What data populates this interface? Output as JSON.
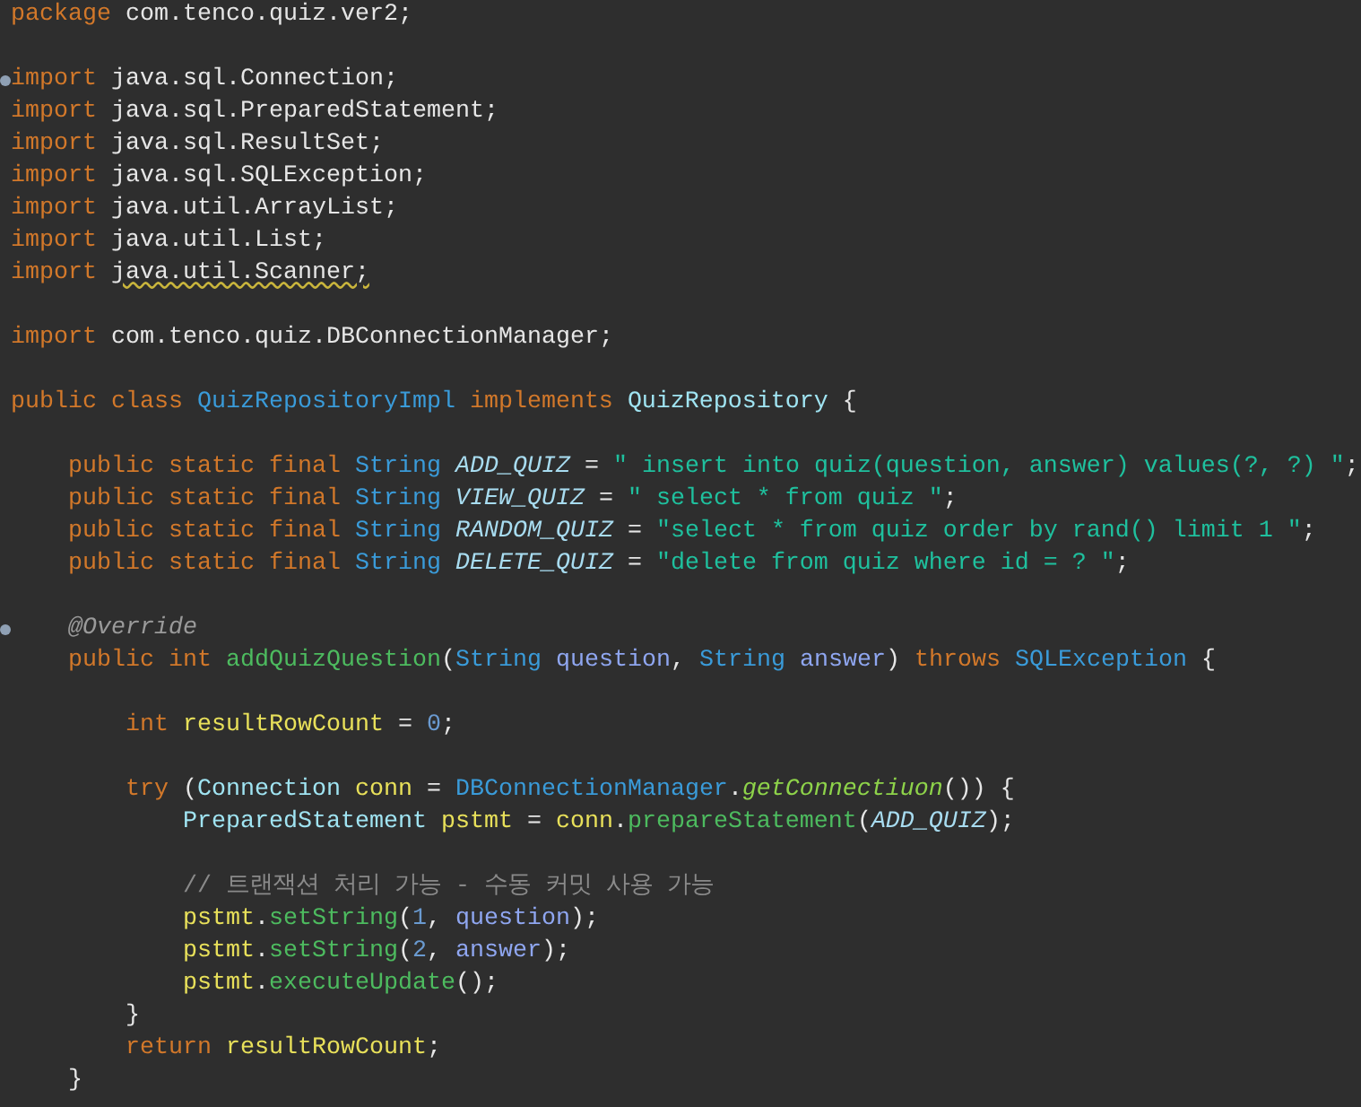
{
  "editor": {
    "lines": [
      {
        "kind": "code",
        "tokens": [
          {
            "text": "package ",
            "kind": "keyword"
          },
          {
            "text": "com.tenco.quiz.ver2;",
            "kind": "plain"
          }
        ]
      },
      {
        "kind": "blank"
      },
      {
        "kind": "marked",
        "tokens": [
          {
            "text": "import ",
            "kind": "keyword"
          },
          {
            "text": "java.sql.Connection;",
            "kind": "plain"
          }
        ]
      },
      {
        "kind": "code",
        "tokens": [
          {
            "text": "import ",
            "kind": "keyword"
          },
          {
            "text": "java.sql.PreparedStatement;",
            "kind": "plain"
          }
        ]
      },
      {
        "kind": "code",
        "tokens": [
          {
            "text": "import ",
            "kind": "keyword"
          },
          {
            "text": "java.sql.ResultSet;",
            "kind": "plain"
          }
        ]
      },
      {
        "kind": "code",
        "tokens": [
          {
            "text": "import ",
            "kind": "keyword"
          },
          {
            "text": "java.sql.SQLException;",
            "kind": "plain"
          }
        ]
      },
      {
        "kind": "code",
        "tokens": [
          {
            "text": "import ",
            "kind": "keyword"
          },
          {
            "text": "java.util.ArrayList;",
            "kind": "plain"
          }
        ]
      },
      {
        "kind": "code",
        "tokens": [
          {
            "text": "import ",
            "kind": "keyword"
          },
          {
            "text": "java.util.List;",
            "kind": "plain"
          }
        ]
      },
      {
        "kind": "code",
        "tokens": [
          {
            "text": "import ",
            "kind": "keyword"
          },
          {
            "text": "java.util.Scanner;",
            "kind": "warning"
          }
        ]
      },
      {
        "kind": "blank"
      },
      {
        "kind": "code",
        "tokens": [
          {
            "text": "import ",
            "kind": "keyword"
          },
          {
            "text": "com.tenco.quiz.DBConnectionManager;",
            "kind": "plain"
          }
        ]
      },
      {
        "kind": "blank"
      },
      {
        "kind": "code",
        "tokens": [
          {
            "text": "public class ",
            "kind": "keyword"
          },
          {
            "text": "QuizRepositoryImpl ",
            "kind": "type"
          },
          {
            "text": "implements ",
            "kind": "keyword"
          },
          {
            "text": "QuizRepository ",
            "kind": "type2"
          },
          {
            "text": "{",
            "kind": "plain"
          }
        ]
      },
      {
        "kind": "blank"
      },
      {
        "kind": "code",
        "tokens": [
          {
            "text": "    public static final ",
            "kind": "keyword"
          },
          {
            "text": "String ",
            "kind": "type"
          },
          {
            "text": "ADD_QUIZ",
            "kind": "constant"
          },
          {
            "text": " = ",
            "kind": "plain"
          },
          {
            "text": "\" insert into quiz(question, answer) values(?, ?) \"",
            "kind": "string"
          },
          {
            "text": ";",
            "kind": "plain"
          }
        ]
      },
      {
        "kind": "code",
        "tokens": [
          {
            "text": "    public static final ",
            "kind": "keyword"
          },
          {
            "text": "String ",
            "kind": "type"
          },
          {
            "text": "VIEW_QUIZ",
            "kind": "constant"
          },
          {
            "text": " = ",
            "kind": "plain"
          },
          {
            "text": "\" select * from quiz \"",
            "kind": "string"
          },
          {
            "text": ";",
            "kind": "plain"
          }
        ]
      },
      {
        "kind": "code",
        "tokens": [
          {
            "text": "    public static final ",
            "kind": "keyword"
          },
          {
            "text": "String ",
            "kind": "type"
          },
          {
            "text": "RANDOM_QUIZ",
            "kind": "constant"
          },
          {
            "text": " = ",
            "kind": "plain"
          },
          {
            "text": "\"select * from quiz order by rand() limit 1 \"",
            "kind": "string"
          },
          {
            "text": ";",
            "kind": "plain"
          }
        ]
      },
      {
        "kind": "code",
        "tokens": [
          {
            "text": "    public static final ",
            "kind": "keyword"
          },
          {
            "text": "String ",
            "kind": "type"
          },
          {
            "text": "DELETE_QUIZ",
            "kind": "constant"
          },
          {
            "text": " = ",
            "kind": "plain"
          },
          {
            "text": "\"delete from quiz where id = ? \"",
            "kind": "string"
          },
          {
            "text": ";",
            "kind": "plain"
          }
        ]
      },
      {
        "kind": "blank"
      },
      {
        "kind": "marked",
        "tokens": [
          {
            "text": "    @Override",
            "kind": "annotation"
          }
        ]
      },
      {
        "kind": "code",
        "tokens": [
          {
            "text": "    public int ",
            "kind": "keyword"
          },
          {
            "text": "addQuizQuestion",
            "kind": "method"
          },
          {
            "text": "(",
            "kind": "plain"
          },
          {
            "text": "String ",
            "kind": "type"
          },
          {
            "text": "question",
            "kind": "param"
          },
          {
            "text": ", ",
            "kind": "plain"
          },
          {
            "text": "String ",
            "kind": "type"
          },
          {
            "text": "answer",
            "kind": "param"
          },
          {
            "text": ") ",
            "kind": "plain"
          },
          {
            "text": "throws ",
            "kind": "keyword"
          },
          {
            "text": "SQLException ",
            "kind": "type"
          },
          {
            "text": "{",
            "kind": "plain"
          }
        ]
      },
      {
        "kind": "blank"
      },
      {
        "kind": "code",
        "tokens": [
          {
            "text": "        int ",
            "kind": "keyword"
          },
          {
            "text": "resultRowCount",
            "kind": "local"
          },
          {
            "text": " = ",
            "kind": "plain"
          },
          {
            "text": "0",
            "kind": "number"
          },
          {
            "text": ";",
            "kind": "plain"
          }
        ]
      },
      {
        "kind": "blank"
      },
      {
        "kind": "code",
        "tokens": [
          {
            "text": "        try ",
            "kind": "keyword"
          },
          {
            "text": "(",
            "kind": "plain"
          },
          {
            "text": "Connection ",
            "kind": "type2"
          },
          {
            "text": "conn",
            "kind": "local"
          },
          {
            "text": " = ",
            "kind": "plain"
          },
          {
            "text": "DBConnectionManager",
            "kind": "type"
          },
          {
            "text": ".",
            "kind": "plain"
          },
          {
            "text": "getConnectiuon",
            "kind": "static_method"
          },
          {
            "text": "()) {",
            "kind": "plain"
          }
        ]
      },
      {
        "kind": "code",
        "tokens": [
          {
            "text": "            PreparedStatement ",
            "kind": "type2"
          },
          {
            "text": "pstmt",
            "kind": "local"
          },
          {
            "text": " = ",
            "kind": "plain"
          },
          {
            "text": "conn",
            "kind": "local"
          },
          {
            "text": ".",
            "kind": "plain"
          },
          {
            "text": "prepareStatement",
            "kind": "method"
          },
          {
            "text": "(",
            "kind": "plain"
          },
          {
            "text": "ADD_QUIZ",
            "kind": "constant"
          },
          {
            "text": ");",
            "kind": "plain"
          }
        ]
      },
      {
        "kind": "blank"
      },
      {
        "kind": "code",
        "tokens": [
          {
            "text": "            // 트랜잭션 처리 가능 - 수동 커밋 사용 가능",
            "kind": "comment"
          }
        ]
      },
      {
        "kind": "code",
        "tokens": [
          {
            "text": "            pstmt",
            "kind": "local"
          },
          {
            "text": ".",
            "kind": "plain"
          },
          {
            "text": "setString",
            "kind": "method"
          },
          {
            "text": "(",
            "kind": "plain"
          },
          {
            "text": "1",
            "kind": "number"
          },
          {
            "text": ", ",
            "kind": "plain"
          },
          {
            "text": "question",
            "kind": "param"
          },
          {
            "text": ");",
            "kind": "plain"
          }
        ]
      },
      {
        "kind": "code",
        "tokens": [
          {
            "text": "            pstmt",
            "kind": "local"
          },
          {
            "text": ".",
            "kind": "plain"
          },
          {
            "text": "setString",
            "kind": "method"
          },
          {
            "text": "(",
            "kind": "plain"
          },
          {
            "text": "2",
            "kind": "number"
          },
          {
            "text": ", ",
            "kind": "plain"
          },
          {
            "text": "answer",
            "kind": "param"
          },
          {
            "text": ");",
            "kind": "plain"
          }
        ]
      },
      {
        "kind": "code",
        "tokens": [
          {
            "text": "            pstmt",
            "kind": "local"
          },
          {
            "text": ".",
            "kind": "plain"
          },
          {
            "text": "executeUpdate",
            "kind": "method"
          },
          {
            "text": "();",
            "kind": "plain"
          }
        ]
      },
      {
        "kind": "code",
        "tokens": [
          {
            "text": "        }",
            "kind": "plain"
          }
        ]
      },
      {
        "kind": "code",
        "tokens": [
          {
            "text": "        return ",
            "kind": "keyword"
          },
          {
            "text": "resultRowCount",
            "kind": "local"
          },
          {
            "text": ";",
            "kind": "plain"
          }
        ]
      },
      {
        "kind": "code",
        "tokens": [
          {
            "text": "    }",
            "kind": "plain"
          }
        ]
      }
    ]
  }
}
